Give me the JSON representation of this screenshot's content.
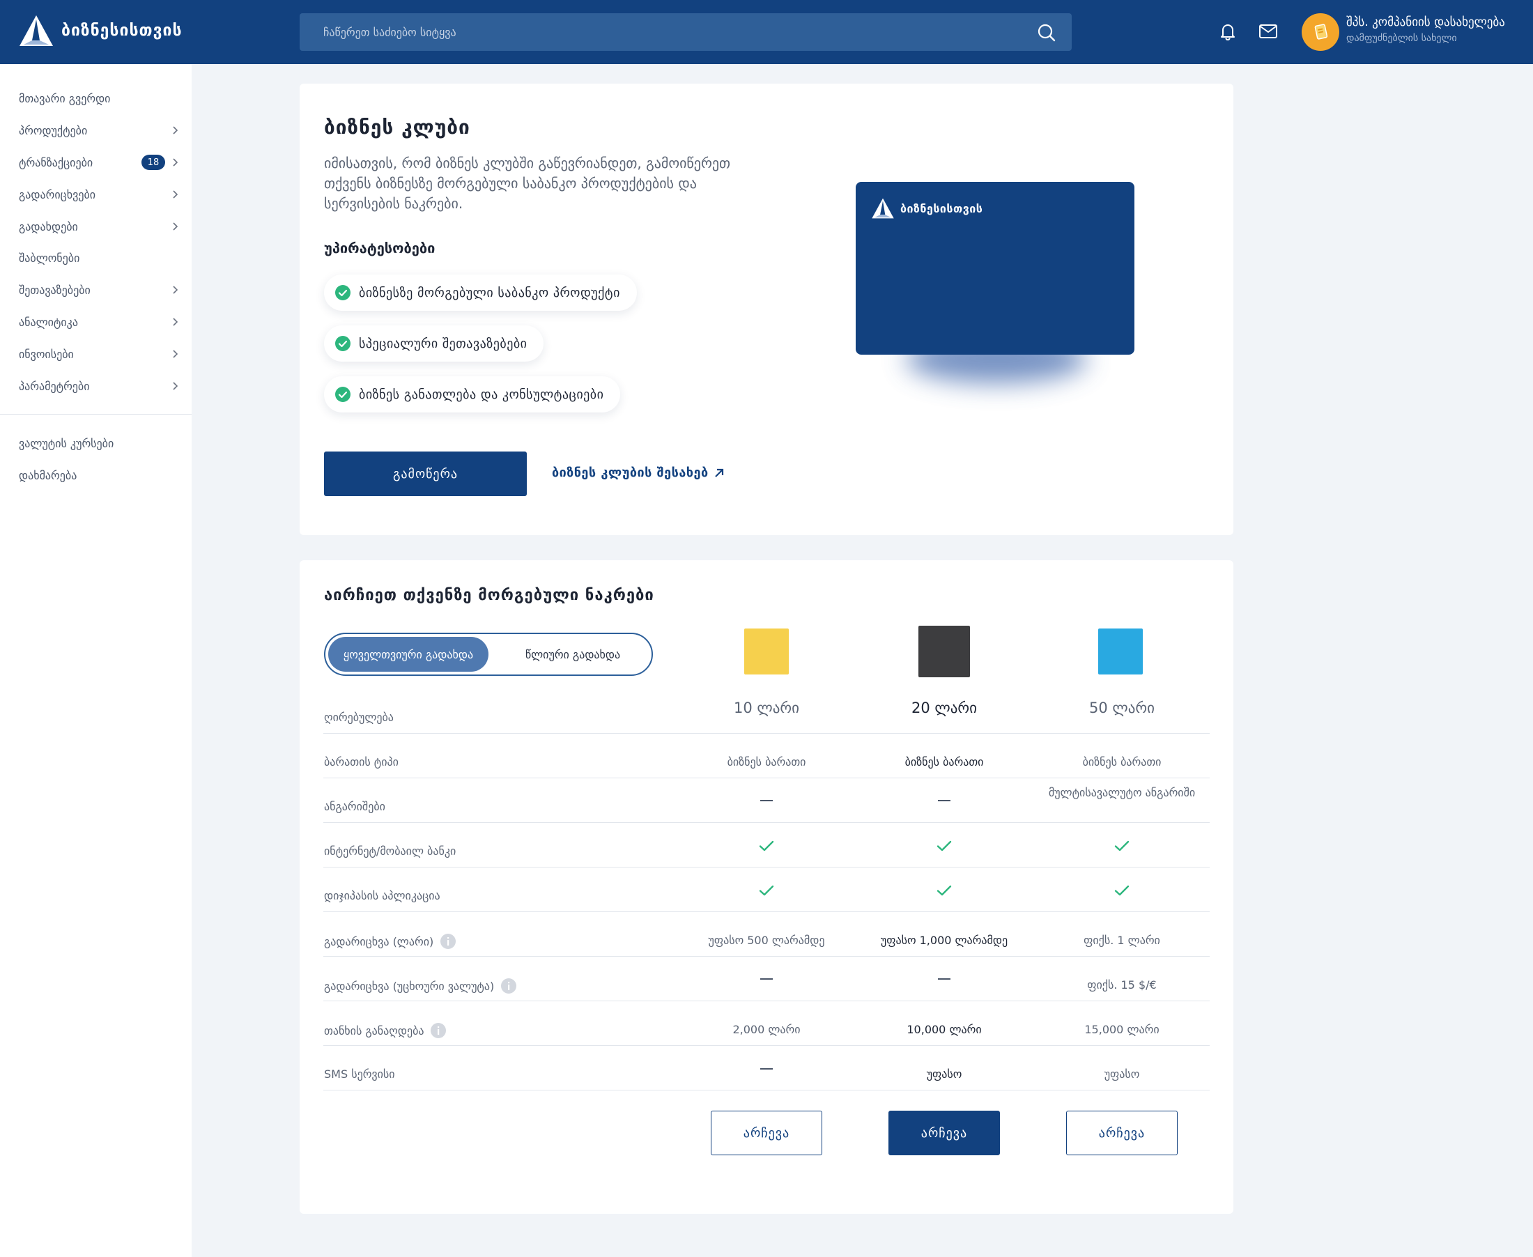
{
  "header": {
    "logo_text": "ბიზნესისთვის",
    "search_placeholder": "ჩაწერეთ საძიებო სიტყვა",
    "company_name": "შპს. კომპანიის დასახელება",
    "company_sub": "დამფუძნებლის სახელი"
  },
  "sidebar": {
    "items": [
      {
        "label": "მთავარი გვერდი"
      },
      {
        "label": "პროდუქტები"
      },
      {
        "label": "ტრანზაქციები",
        "badge": "18"
      },
      {
        "label": "გადარიცხვები"
      },
      {
        "label": "გადახდები"
      },
      {
        "label": "შაბლონები"
      },
      {
        "label": "შეთავაზებები"
      },
      {
        "label": "ანალიტიკა"
      },
      {
        "label": "ინვოისები"
      },
      {
        "label": "პარამეტრები"
      }
    ],
    "secondary": [
      {
        "label": "ვალუტის კურსები"
      },
      {
        "label": "დახმარება"
      }
    ]
  },
  "club": {
    "title": "ბიზნეს კლუბი",
    "description": "იმისათვის, რომ ბიზნეს კლუბში გაწევრიანდეთ, გამოიწერეთ თქვენს ბიზნესზე მორგებული საბანკო პროდუქტების და სერვისების ნაკრები.",
    "advantages_title": "უპირატესობები",
    "advantages": [
      "ბიზნესზე მორგებული საბანკო პროდუქტი",
      "სპეციალური შეთავაზებები",
      "ბიზნეს განათლება და კონსულტაციები"
    ],
    "subscribe_label": "გამოწერა",
    "about_link": "ბიზნეს კლუბის შესახებ",
    "card_logo_text": "ბიზნესისთვის"
  },
  "plans": {
    "title": "აირჩიეთ თქვენზე მორგებული ნაკრები",
    "toggle_monthly": "ყოველთვიური გადახდა",
    "toggle_yearly": "წლიური გადახდა",
    "columns": [
      {
        "price": "10 ლარი",
        "color": "#f6d04d"
      },
      {
        "price": "20 ლარი",
        "color": "#3d3d3f"
      },
      {
        "price": "50 ლარი",
        "color": "#29a9e1"
      }
    ],
    "rows": [
      {
        "label": "ღირებულება"
      },
      {
        "label": "ბარათის ტიპი",
        "values": [
          "ბიზნეს ბარათი",
          "ბიზნეს ბარათი",
          "ბიზნეს ბარათი"
        ]
      },
      {
        "label": "ანგარიშები",
        "values": [
          "—",
          "—",
          "მულტისავალუტო ანგარიში"
        ]
      },
      {
        "label": "ინტერნეტ/მობაილ ბანკი",
        "values": [
          "check",
          "check",
          "check"
        ]
      },
      {
        "label": "დიჯიპასის აპლიკაცია",
        "values": [
          "check",
          "check",
          "check"
        ]
      },
      {
        "label": "გადარიცხვა (ლარი)",
        "values": [
          "უფასო 500 ლარამდე",
          "უფასო 1,000 ლარამდე",
          "ფიქს. 1 ლარი"
        ]
      },
      {
        "label": "გადარიცხვა (უცხოური ვალუტა)",
        "values": [
          "—",
          "—",
          "ფიქს. 15 $/€"
        ]
      },
      {
        "label": "თანხის განაღდება",
        "values": [
          "2,000 ლარი",
          "10,000 ლარი",
          "15,000 ლარი"
        ]
      },
      {
        "label": "SMS სერვისი",
        "values": [
          "—",
          "უფასო",
          "უფასო"
        ]
      }
    ],
    "choose_label": "არჩევა"
  },
  "colors": {
    "brand": "#12417f",
    "success": "#2cb67d"
  }
}
